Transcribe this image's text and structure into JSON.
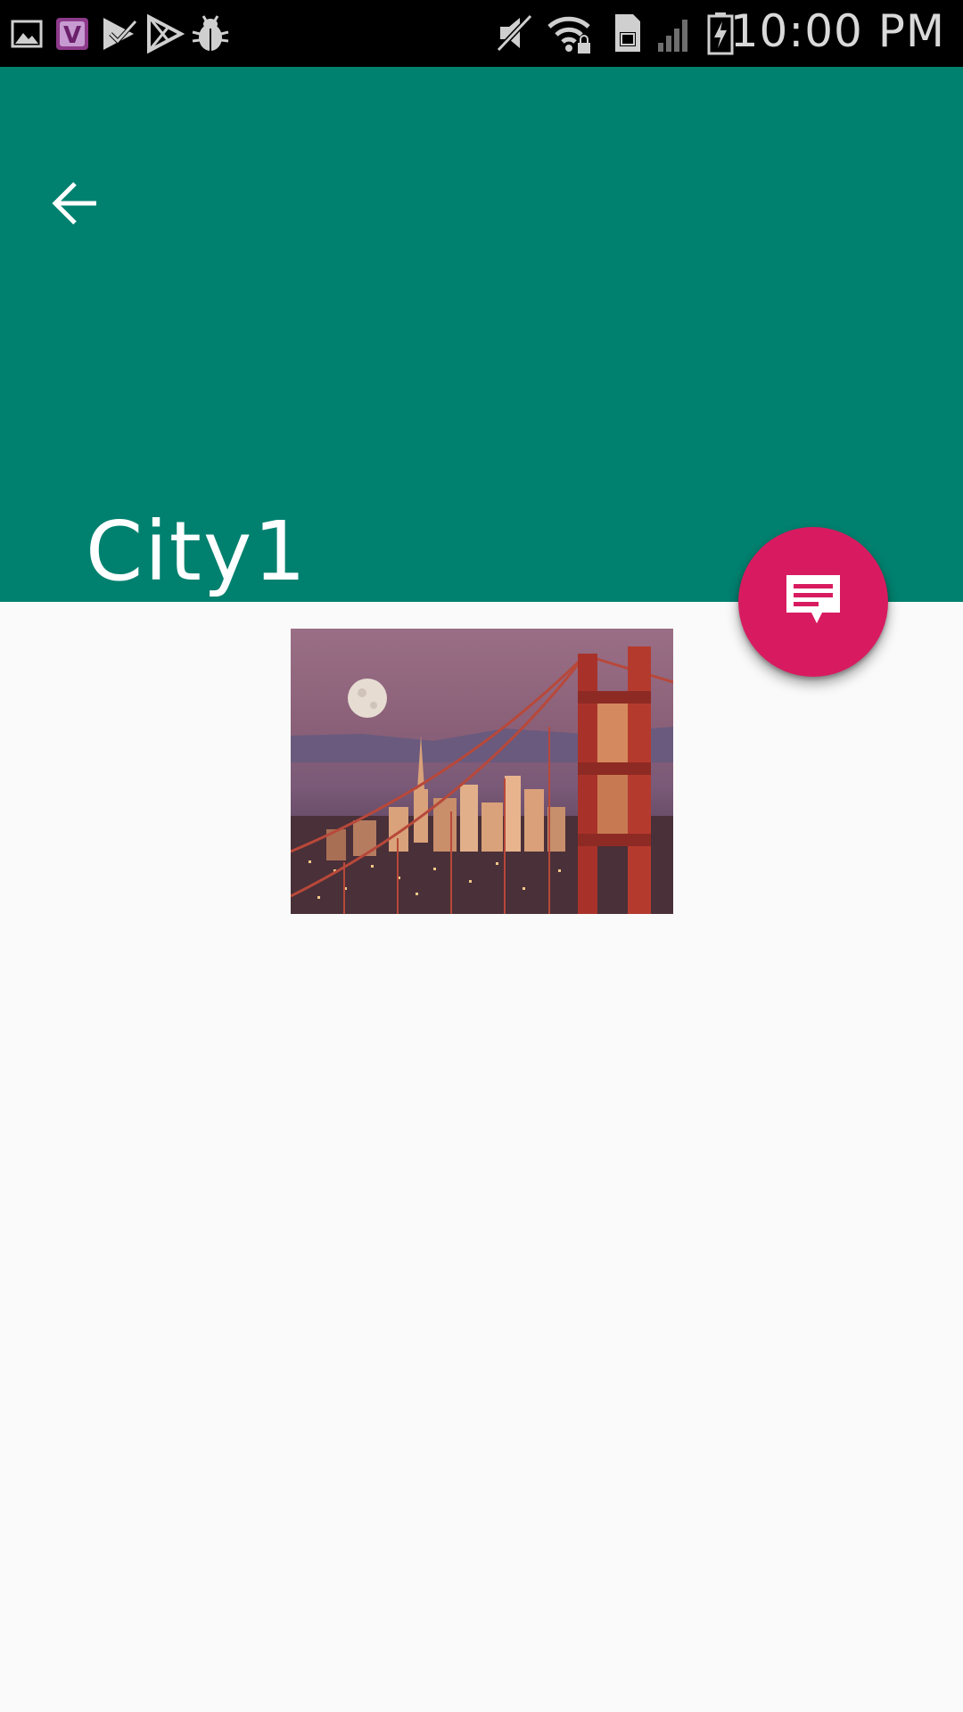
{
  "status_bar": {
    "time": "10:00 PM",
    "left_icons": [
      "gallery-icon",
      "viber-icon",
      "tasks-icon",
      "play-store-icon",
      "bug-icon"
    ],
    "right_icons": [
      "mute-icon",
      "wifi-icon",
      "sim-icon",
      "signal-icon",
      "battery-icon"
    ]
  },
  "app_bar": {
    "title": "City1",
    "background_color": "#00816f",
    "back_icon": "arrow-back-icon"
  },
  "fab": {
    "icon": "message-icon",
    "color": "#d81b60"
  },
  "content": {
    "image": "city-bridge-photo"
  }
}
